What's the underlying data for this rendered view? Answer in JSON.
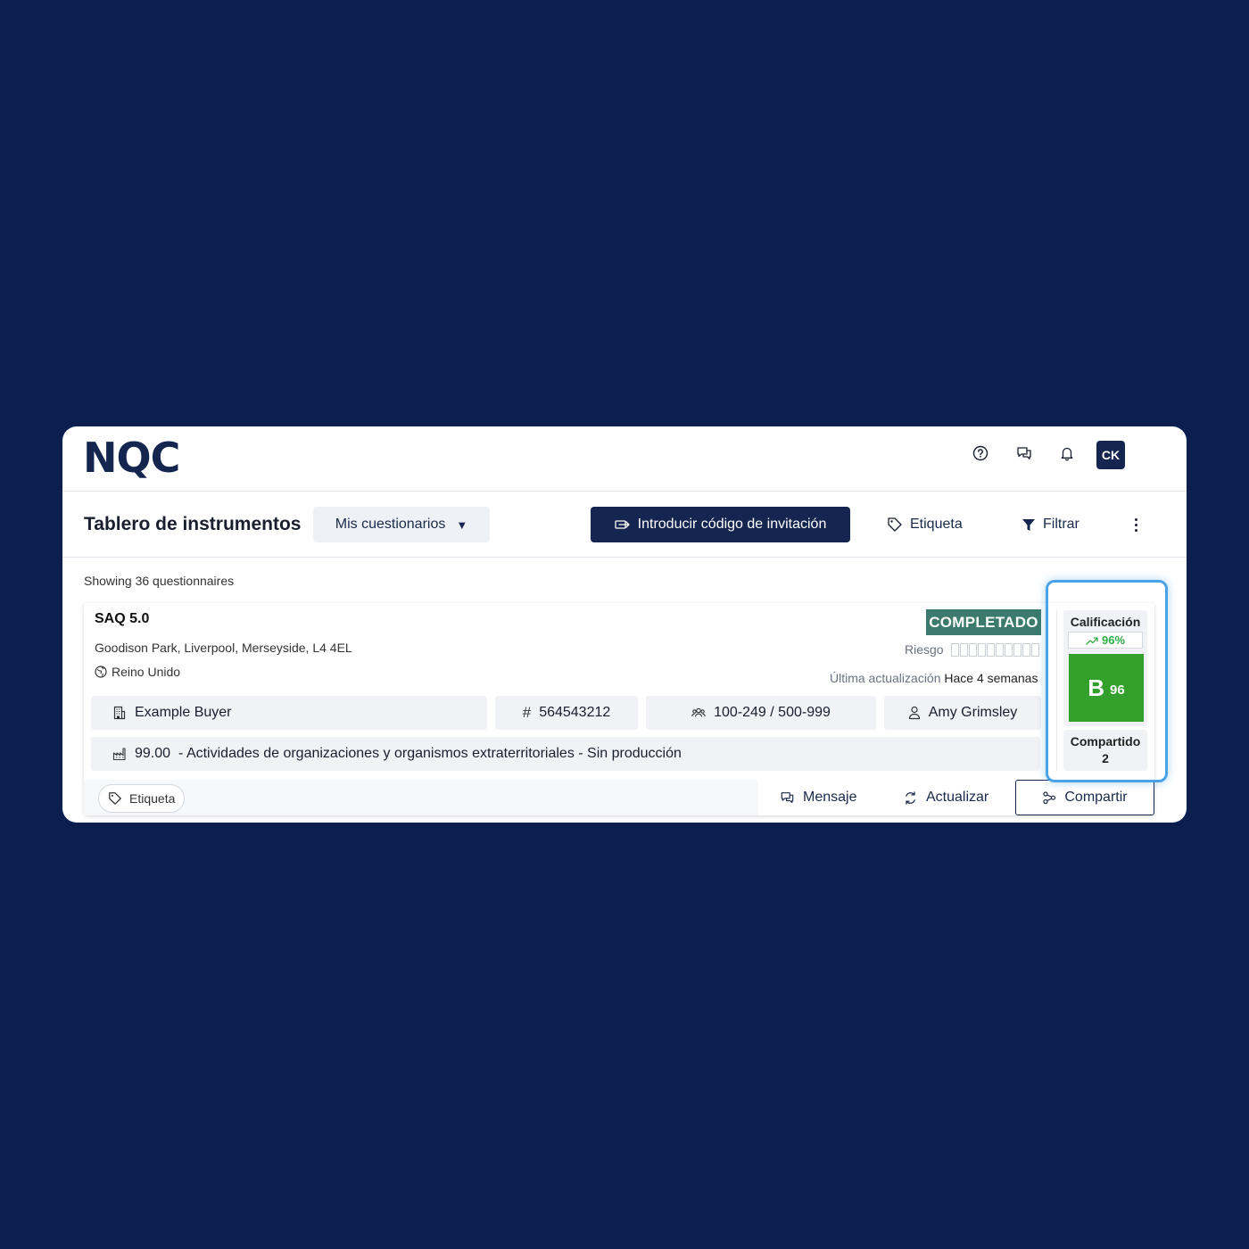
{
  "app": {
    "logo": "NQC",
    "avatar_initials": "CK"
  },
  "nav_icons": [
    "help-icon",
    "chat-icon",
    "bell-icon"
  ],
  "toolbar": {
    "title": "Tablero de instrumentos",
    "dropdown_value": "Mis cuestionarios",
    "invite_label": "Introducir código de invitación",
    "tag_label": "Etiqueta",
    "filter_label": "Filtrar"
  },
  "list": {
    "showing_text": "Showing 36 questionnaires"
  },
  "card": {
    "title": "SAQ 5.0",
    "address": "Goodison Park, Liverpool, Merseyside, L4 4EL",
    "country": "Reino Unido",
    "status": "COMPLETADO",
    "status_color": "#3b7a6c",
    "risk_label": "Riesgo",
    "risk_level": 0,
    "updated_label": "Última actualización",
    "updated_value": "Hace 4 semanas",
    "chips": {
      "buyer": "Example Buyer",
      "id": "564543212",
      "size": "100-249 / 500-999",
      "contact": "Amy Grimsley"
    },
    "industry_code": "99.00",
    "industry_text": "- Actividades de organizaciones y organismos extraterritoriales - Sin producción",
    "rating": {
      "label": "Calificación",
      "trend": "96%",
      "grade_letter": "B",
      "grade_score": "96",
      "grade_color": "#33a02c"
    },
    "shared": {
      "label": "Compartido",
      "count": "2"
    },
    "footer": {
      "tag_label": "Etiqueta",
      "message_label": "Mensaje",
      "update_label": "Actualizar",
      "share_label": "Compartir"
    }
  },
  "colors": {
    "background": "#0b1f4f",
    "primary": "#14254f",
    "highlight": "#4aa3e8"
  }
}
